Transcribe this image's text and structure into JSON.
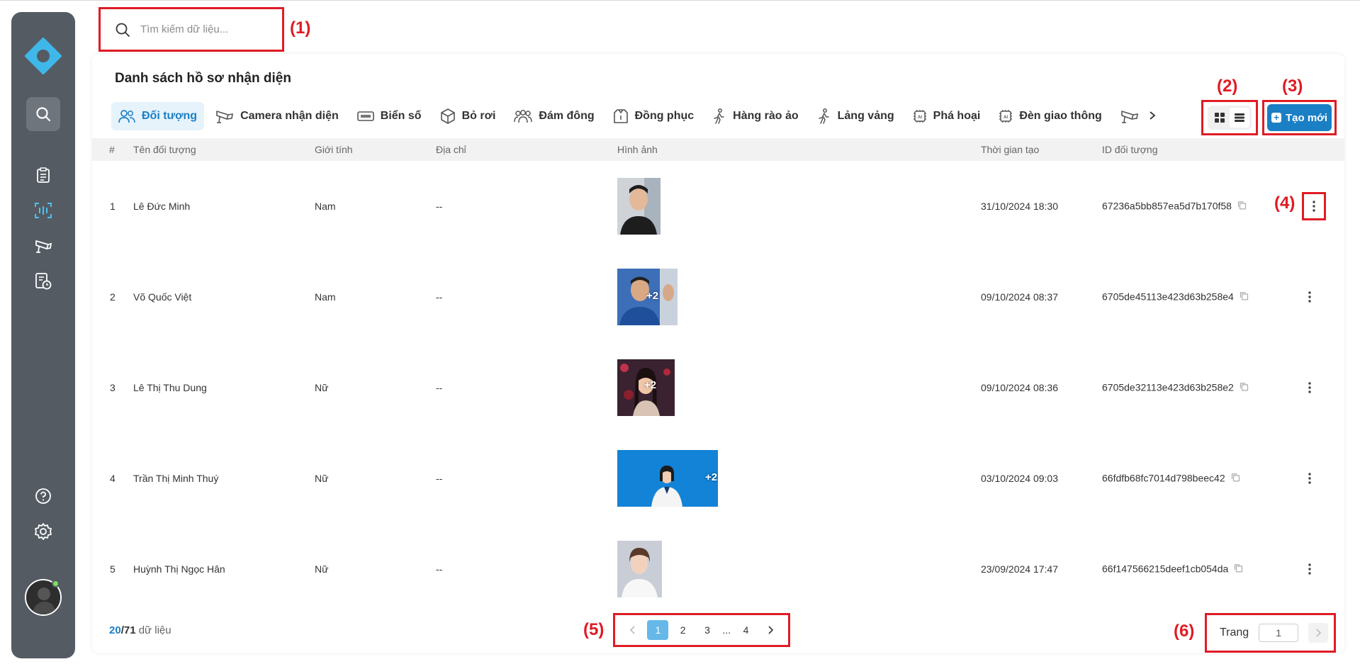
{
  "search": {
    "placeholder": "Tìm kiếm dữ liệu..."
  },
  "annotations": {
    "a1": "(1)",
    "a2": "(2)",
    "a3": "(3)",
    "a4": "(4)",
    "a5": "(5)",
    "a6": "(6)"
  },
  "page_title": "Danh sách hồ sơ nhận diện",
  "tabs": [
    {
      "label": "Đối tượng",
      "icon": "people-icon",
      "active": true
    },
    {
      "label": "Camera nhận diện",
      "icon": "camera-icon"
    },
    {
      "label": "Biển số",
      "icon": "license-plate-icon"
    },
    {
      "label": "Bỏ rơi",
      "icon": "box-icon"
    },
    {
      "label": "Đám đông",
      "icon": "crowd-icon"
    },
    {
      "label": "Đồng phục",
      "icon": "uniform-icon"
    },
    {
      "label": "Hàng rào ảo",
      "icon": "walking-icon"
    },
    {
      "label": "Lảng vảng",
      "icon": "walking-icon"
    },
    {
      "label": "Phá hoại",
      "icon": "ai-chip-icon"
    },
    {
      "label": "Đèn giao thông",
      "icon": "ai-chip-icon"
    }
  ],
  "create_button": "Tạo mới",
  "table": {
    "headers": {
      "index": "#",
      "name": "Tên đối tượng",
      "gender": "Giới tính",
      "address": "Địa chỉ",
      "image": "Hình ảnh",
      "created": "Thời gian tạo",
      "id": "ID đối tượng"
    },
    "rows": [
      {
        "index": "1",
        "name": "Lê Đức Minh",
        "gender": "Nam",
        "address": "--",
        "extra": "",
        "created": "31/10/2024 18:30",
        "id": "67236a5bb857ea5d7b170f58"
      },
      {
        "index": "2",
        "name": "Võ Quốc Việt",
        "gender": "Nam",
        "address": "--",
        "extra": "+2",
        "created": "09/10/2024 08:37",
        "id": "6705de45113e423d63b258e4"
      },
      {
        "index": "3",
        "name": "Lê Thị Thu Dung",
        "gender": "Nữ",
        "address": "--",
        "extra": "+2",
        "created": "09/10/2024 08:36",
        "id": "6705de32113e423d63b258e2"
      },
      {
        "index": "4",
        "name": "Trần Thị Minh Thuý",
        "gender": "Nữ",
        "address": "--",
        "extra": "+2",
        "created": "03/10/2024 09:03",
        "id": "66fdfb68fc7014d798beec42"
      },
      {
        "index": "5",
        "name": "Huỳnh Thị Ngọc Hân",
        "gender": "Nữ",
        "address": "--",
        "extra": "",
        "created": "23/09/2024 17:47",
        "id": "66f147566215deef1cb054da"
      }
    ]
  },
  "footer": {
    "shown": "20",
    "total": "/71",
    "suffix": " dữ liệu",
    "pages": [
      "1",
      "2",
      "3",
      "...",
      "4"
    ],
    "goto_label": "Trang",
    "goto_value": "1"
  },
  "colors": {
    "accent": "#1a7fc4",
    "highlight": "#e01b24",
    "sidebar": "#545b63"
  }
}
